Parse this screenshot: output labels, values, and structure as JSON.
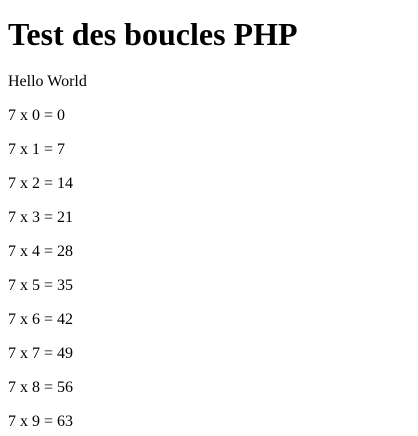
{
  "page": {
    "title": "Test des boucles PHP",
    "intro": "Hello World",
    "lines": [
      "7 x 0 = 0",
      "7 x 1 = 7",
      "7 x 2 = 14",
      "7 x 3 = 21",
      "7 x 4 = 28",
      "7 x 5 = 35",
      "7 x 6 = 42",
      "7 x 7 = 49",
      "7 x 8 = 56",
      "7 x 9 = 63"
    ]
  }
}
